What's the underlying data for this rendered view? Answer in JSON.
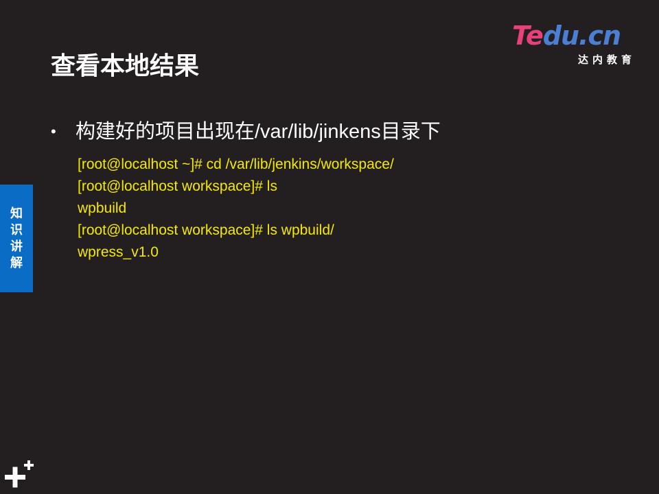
{
  "slide": {
    "title": "查看本地结果",
    "bullet": {
      "text": "构建好的项目出现在/var/lib/jinkens目录下"
    },
    "code_lines": [
      "[root@localhost ~]# cd /var/lib/jenkins/workspace/",
      "[root@localhost workspace]# ls",
      "wpbuild",
      "[root@localhost workspace]# ls wpbuild/",
      "wpress_v1.0"
    ],
    "side_tab": {
      "label": "知识讲解"
    },
    "logo": {
      "brand_highlight": "Te",
      "brand_rest": "du.cn",
      "subtitle": "达内教育"
    },
    "icons": {
      "bullet": "bullet-dot-icon",
      "corner": "plus-icon"
    },
    "colors": {
      "background": "#231f20",
      "title": "#ffffff",
      "code_text": "#f5e900",
      "side_tab": "#0a6cc4",
      "logo_pink": "#e8407a",
      "logo_blue": "#4a7fd4"
    }
  }
}
